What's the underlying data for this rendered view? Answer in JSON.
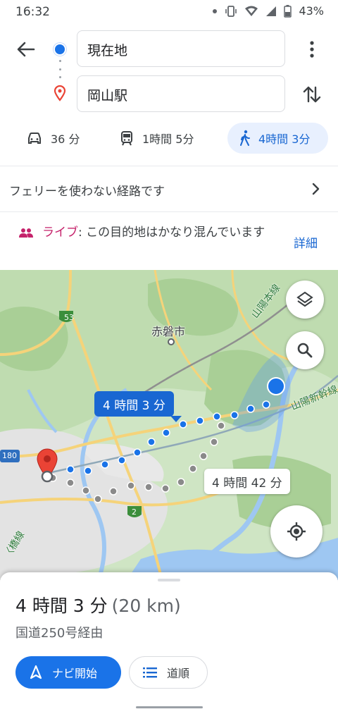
{
  "status_bar": {
    "time": "16:32",
    "battery": "43%",
    "icons": [
      "notification-dot-icon",
      "vibrate-icon",
      "wifi-icon",
      "signal-icon",
      "battery-icon"
    ]
  },
  "search": {
    "origin": "現在地",
    "destination": "岡山駅"
  },
  "modes": [
    {
      "icon": "car-icon",
      "label": "36 分"
    },
    {
      "icon": "train-icon",
      "label": "1時間 5分"
    },
    {
      "icon": "walk-icon",
      "label": "4時間 3分",
      "selected": true
    }
  ],
  "notices": {
    "ferry": "フェリーを使わない経路です",
    "live_label": "ライブ",
    "live_text": ": この目的地はかなり混んでいます",
    "live_detail": "詳細"
  },
  "map": {
    "labels": {
      "city": "赤磐市",
      "rail_sanyo_main": "山陽本線",
      "rail_shinkansen": "山陽新幹線",
      "rail_left": "〈橋線",
      "route_53": "53",
      "route_180": "180",
      "route_2": "2"
    },
    "route_primary_label": "4 時間 3 分",
    "route_alt_label": "4 時間 42 分",
    "controls": [
      "layers-icon",
      "search-icon",
      "my-location-icon"
    ]
  },
  "sheet": {
    "duration": "4 時間 3 分",
    "distance": "(20 km)",
    "via": "国道250号経由",
    "start_label": "ナビ開始",
    "steps_label": "道順"
  },
  "colors": {
    "accent": "#1a73e8",
    "selected_mode_bg": "#e8f0fe",
    "live": "#c5226b",
    "destination_pin": "#ea4335"
  }
}
